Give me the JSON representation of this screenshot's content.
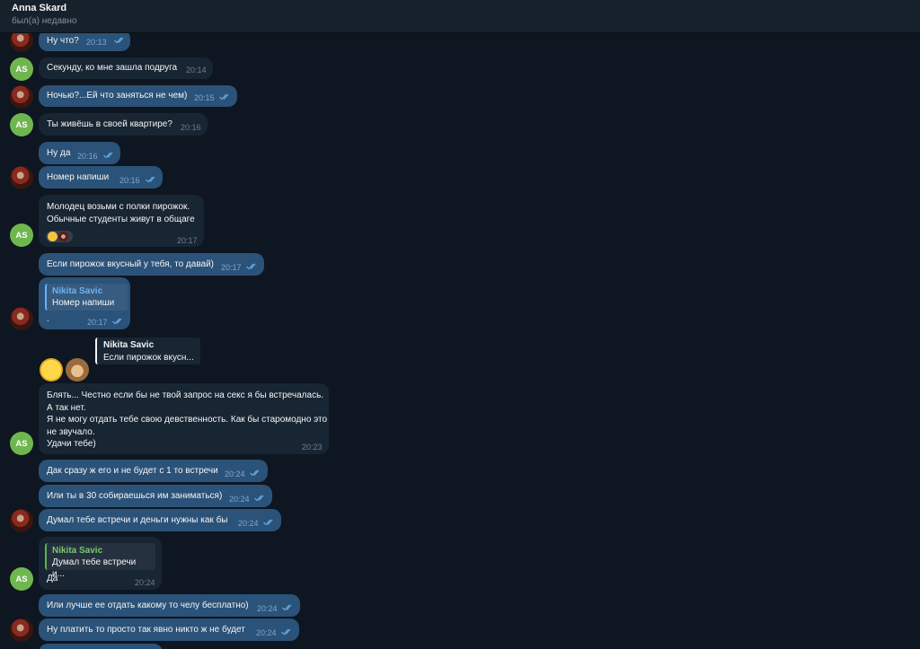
{
  "header": {
    "name": "Anna Skard",
    "status": "был(а) недавно"
  },
  "messages": [
    {
      "text": "Ну что?",
      "time": "20:13"
    },
    {
      "text": "Секунду, ко мне зашла подруга",
      "time": "20:14"
    },
    {
      "text": "Ночью?...Ей что заняться не чем)",
      "time": "20:15"
    },
    {
      "text": "Ты живёшь в своей квартире?",
      "time": "20:16"
    },
    {
      "text": "Ну да",
      "time": "20:16"
    },
    {
      "text": "Номер напиши",
      "time": "20:16"
    },
    {
      "lines": [
        "Молодец возьми с полки пирожок.",
        "Обычные студенты живут в общаге"
      ],
      "time": "20:17"
    },
    {
      "text": "Если пирожок вкусный у тебя, то давай)",
      "time": "20:17"
    },
    {
      "reply_name": "Nikita Savic",
      "reply_text": "Номер напиши",
      "text": ".",
      "time": "20:17"
    },
    {
      "reply_name": "Nikita Savic",
      "reply_text": "Если пирожок вкусн..."
    },
    {
      "lines": [
        "Блять... Честно если бы не твой запрос на секс я бы встречалась.",
        "А так нет.",
        "Я не могу отдать тебе свою девственность. Как бы старомодно это",
        "не звучало.",
        "Удачи тебе)"
      ],
      "time": "20:23"
    },
    {
      "text": "Дак сразу ж его и не будет с 1 то встречи",
      "time": "20:24"
    },
    {
      "text": "Или ты в 30 собираешься им заниматься)",
      "time": "20:24"
    },
    {
      "text": "Думал тебе встречи и деньги нужны как бы",
      "time": "20:24"
    },
    {
      "reply_name": "Nikita Savic",
      "reply_text": "Думал тебе встречи и...",
      "text": "Да",
      "time": "20:24"
    },
    {
      "text": "Или лучше ее отдать какому то челу бесплатно)",
      "time": "20:24"
    },
    {
      "text": "Ну платить то просто так явно никто ж не будет",
      "time": "20:24"
    }
  ],
  "avatars": {
    "contact_initials": "AS"
  },
  "colors": {
    "outgoing": "#2b5278",
    "incoming": "#182533",
    "background": "#0e1621",
    "accent": "#6ab3f3"
  }
}
